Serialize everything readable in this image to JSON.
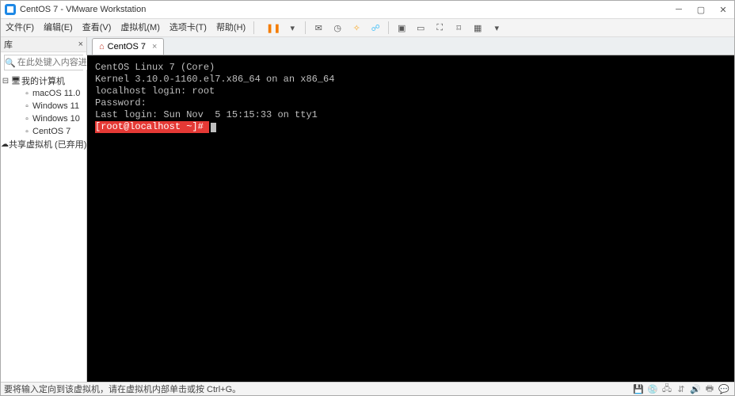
{
  "titlebar": {
    "title": "CentOS 7 - VMware Workstation"
  },
  "menu": [
    "文件(F)",
    "编辑(E)",
    "查看(V)",
    "虚拟机(M)",
    "选项卡(T)",
    "帮助(H)"
  ],
  "sidebar": {
    "header": "库",
    "search_placeholder": "在此处键入内容进行搜索",
    "tree": [
      {
        "label": "我的计算机",
        "children": [
          "macOS 11.0",
          "Windows 11",
          "Windows 10",
          "CentOS 7"
        ]
      },
      {
        "label": "共享虚拟机 (已弃用)"
      }
    ]
  },
  "tabs": [
    {
      "label": "CentOS 7"
    }
  ],
  "console": {
    "lines": [
      "CentOS Linux 7 (Core)",
      "Kernel 3.10.0-1160.el7.x86_64 on an x86_64",
      "",
      "localhost login: root",
      "Password:",
      "Last login: Sun Nov  5 15:15:33 on tty1"
    ],
    "prompt": "[root@localhost ~]# "
  },
  "status": {
    "text": "要将输入定向到该虚拟机，请在虚拟机内部单击或按 Ctrl+G。"
  }
}
